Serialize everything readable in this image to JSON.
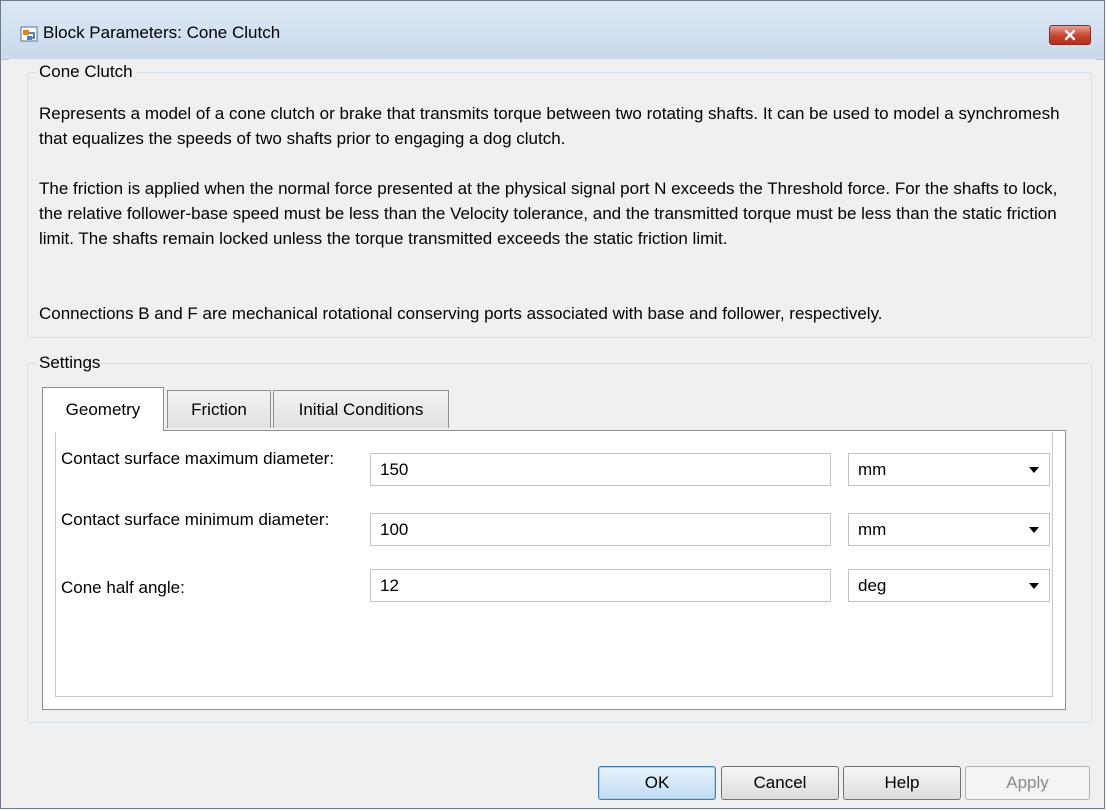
{
  "window": {
    "title": "Block Parameters: Cone Clutch"
  },
  "description_group": {
    "title": "Cone Clutch",
    "paragraphs": [
      "Represents a model of a cone clutch or brake that transmits torque between two rotating shafts. It can be used to model a synchromesh that equalizes the speeds of two shafts prior to engaging a dog clutch.",
      "The friction is applied when the normal force presented at the physical signal port N exceeds the Threshold force. For the shafts to lock, the relative follower-base speed must be less than the Velocity tolerance, and the transmitted torque must be less than the static friction limit. The shafts remain locked unless the torque transmitted exceeds the static friction limit.",
      "Connections B and F are mechanical rotational conserving ports associated with base and follower, respectively."
    ]
  },
  "settings_group": {
    "title": "Settings",
    "tabs": [
      {
        "label": "Geometry",
        "active": true
      },
      {
        "label": "Friction",
        "active": false
      },
      {
        "label": "Initial Conditions",
        "active": false
      }
    ],
    "params": [
      {
        "label": "Contact surface maximum diameter:",
        "value": "150",
        "unit": "mm"
      },
      {
        "label": "Contact surface minimum diameter:",
        "value": "100",
        "unit": "mm"
      },
      {
        "label": "Cone half angle:",
        "value": "12",
        "unit": "deg"
      }
    ]
  },
  "buttons": {
    "ok": "OK",
    "cancel": "Cancel",
    "help": "Help",
    "apply": "Apply"
  },
  "colors": {
    "close_button": "#c7422b",
    "default_button_border": "#3c7fb1"
  }
}
